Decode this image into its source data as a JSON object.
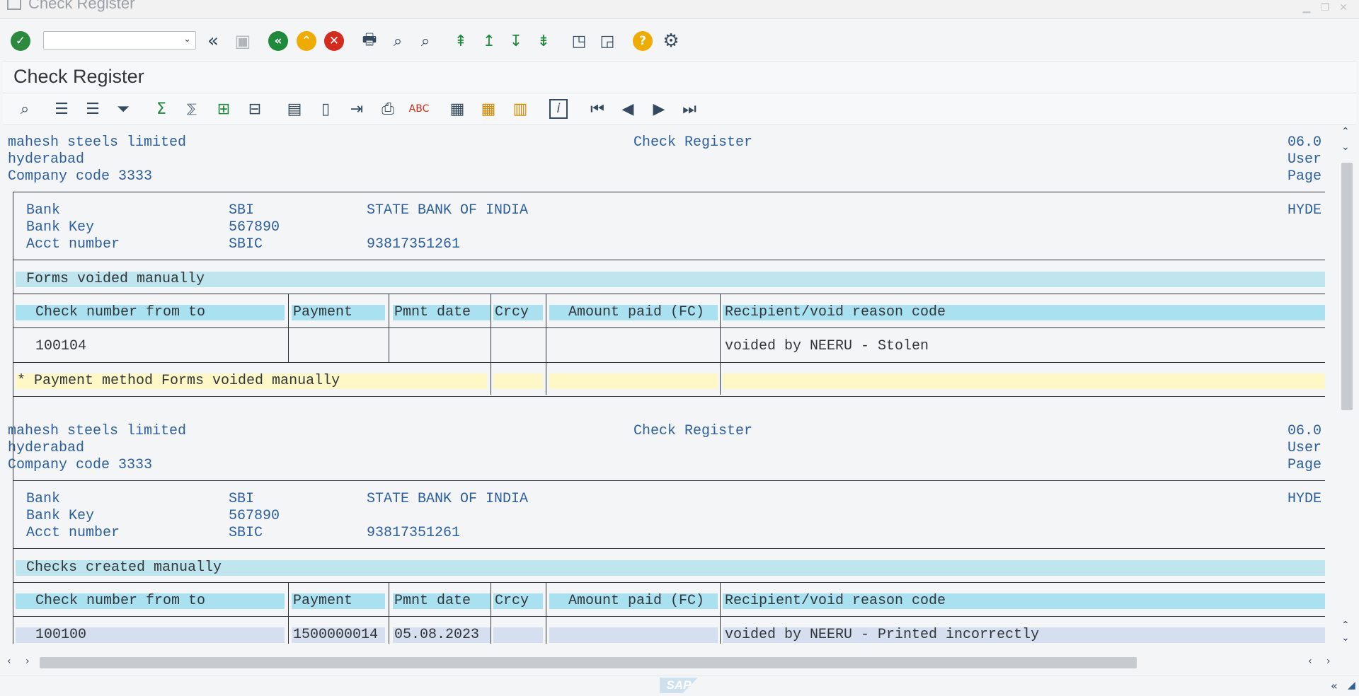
{
  "window": {
    "title": "Check Register"
  },
  "toolbar": {
    "command_field_value": "",
    "icons": [
      "enter-icon",
      "back-double-icon",
      "save-icon",
      "back-icon",
      "exit-icon",
      "cancel-icon",
      "print-icon",
      "find-icon",
      "find-next-icon",
      "first-page-icon",
      "previous-page-icon",
      "next-page-icon",
      "last-page-icon",
      "create-session-icon",
      "generate-shortcut-icon",
      "help-icon",
      "customize-layout-icon"
    ]
  },
  "page_title": "Check Register",
  "alv_toolbar": {
    "icons": [
      "details-icon",
      "sort-ascending-icon",
      "sort-descending-icon",
      "filter-icon",
      "total-icon",
      "subtotal-icon",
      "expand-icon",
      "collapse-icon",
      "spreadsheet-icon",
      "word-processing-icon",
      "local-file-icon",
      "print-preview-icon",
      "abc-analysis-icon",
      "change-layout-icon",
      "select-layout-icon",
      "save-layout-icon",
      "information-icon",
      "first-page-icon",
      "previous-page-icon",
      "next-page-icon",
      "last-page-icon"
    ]
  },
  "sections": [
    {
      "company": "mahesh steels limited",
      "report_title": "Check Register",
      "right1": "06.0",
      "city": "hyderabad",
      "right2": "User",
      "company_code": "Company code 3333",
      "right3": "Page",
      "bank_label": "Bank",
      "bank_id": "SBI",
      "bank_name": "STATE BANK OF INDIA",
      "bank_city": "HYDE",
      "bank_key_label": "Bank Key",
      "bank_key": "567890",
      "acct_label": "Acct number",
      "acct_code": "SBIC",
      "acct_number": "93817351261",
      "group_title": "Forms voided manually",
      "columns": [
        "Check number from to",
        "Payment",
        "Pmnt date",
        "Crcy",
        "Amount paid (FC)",
        "Recipient/void reason code"
      ],
      "rows": [
        {
          "check": "100104",
          "payment": "",
          "date": "",
          "crcy": "",
          "amount": "",
          "reason": "voided by NEERU - Stolen"
        }
      ],
      "subtotal": "* Payment method Forms voided manually"
    },
    {
      "company": "mahesh steels limited",
      "report_title": "Check Register",
      "right1": "06.0",
      "city": "hyderabad",
      "right2": "User",
      "company_code": "Company code 3333",
      "right3": "Page",
      "bank_label": "Bank",
      "bank_id": "SBI",
      "bank_name": "STATE BANK OF INDIA",
      "bank_city": "HYDE",
      "bank_key_label": "Bank Key",
      "bank_key": "567890",
      "acct_label": "Acct number",
      "acct_code": "SBIC",
      "acct_number": "93817351261",
      "group_title": "Checks created manually",
      "columns": [
        "Check number from to",
        "Payment",
        "Pmnt date",
        "Crcy",
        "Amount paid (FC)",
        "Recipient/void reason code"
      ],
      "rows": [
        {
          "check": "100100",
          "payment": "1500000014",
          "date": "05.08.2023",
          "crcy": "",
          "amount": "",
          "reason": "voided by NEERU - Printed incorrectly"
        }
      ]
    }
  ],
  "status_bar": {
    "logo": "SAP"
  },
  "colors": {
    "accept": "#2b8a3e",
    "nav_green": "#1e8a3c",
    "nav_orange": "#f0ab00",
    "cancel_red": "#d52b1e",
    "help": "#f0ab00",
    "report_text": "#2b5fa0",
    "header_cell": "#a9e1f1",
    "group_band": "#bfe6ee",
    "subtotal": "#fef8c6"
  }
}
